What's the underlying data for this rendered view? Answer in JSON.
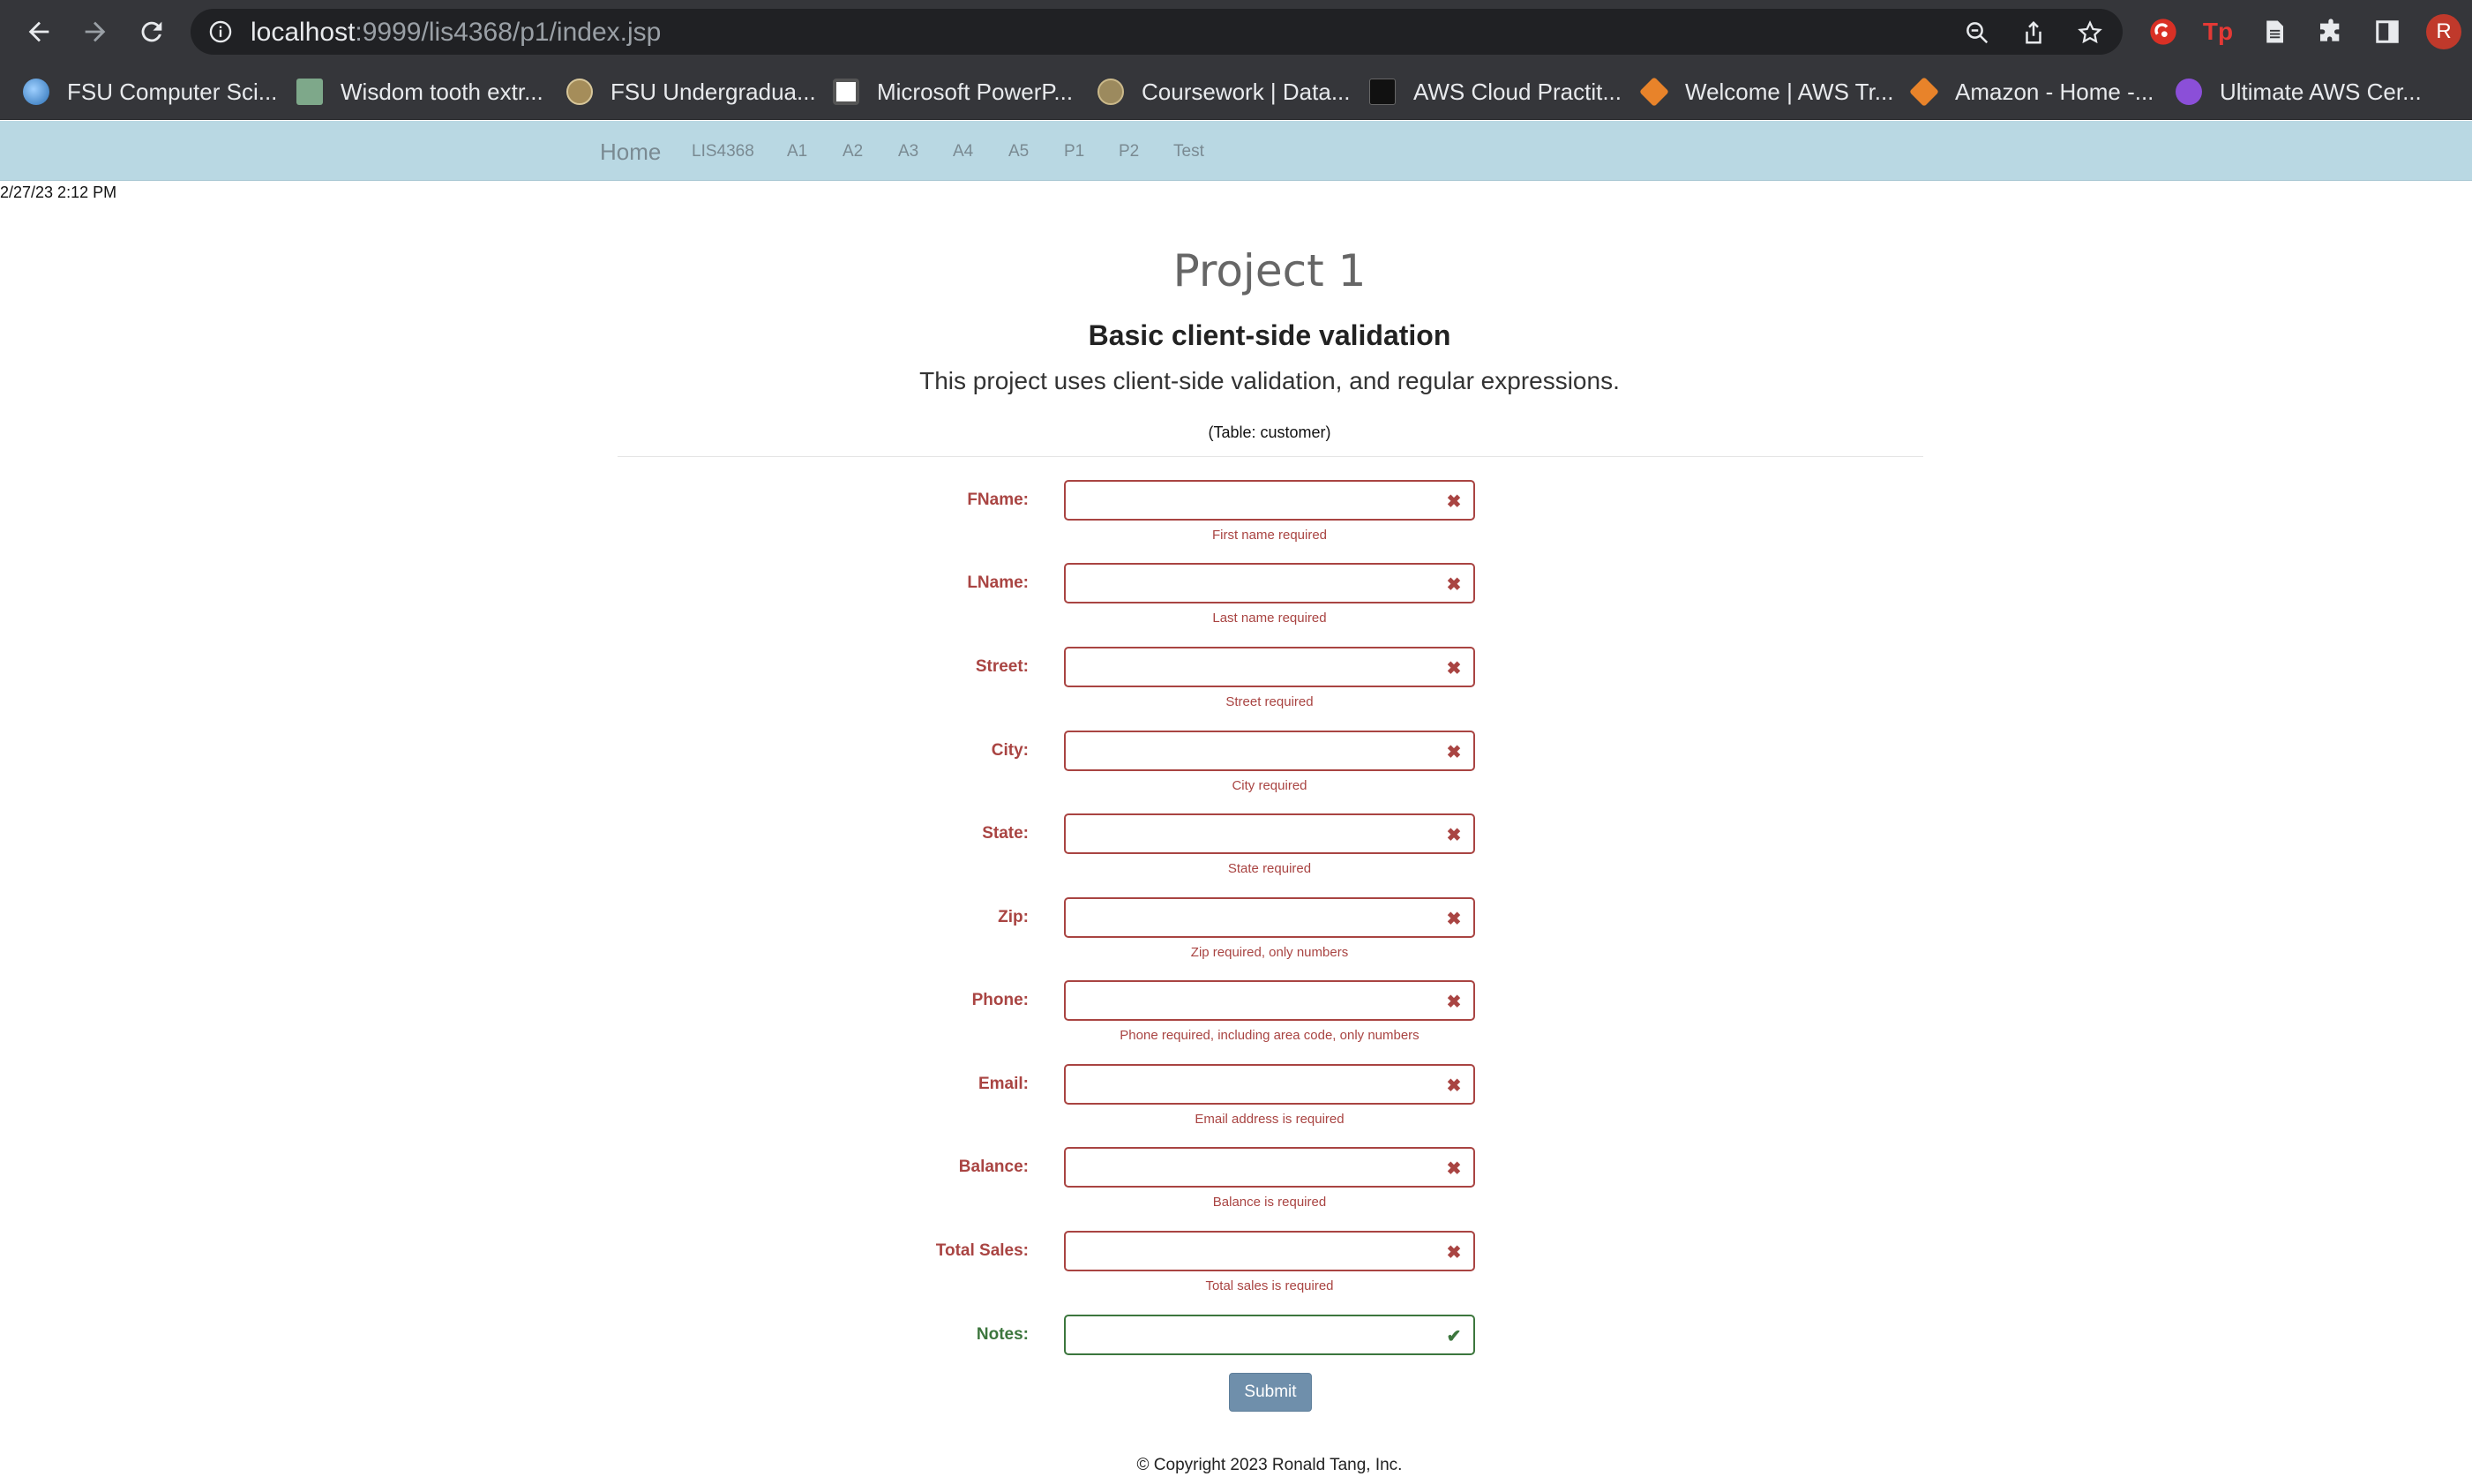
{
  "browser": {
    "url_host": "localhost",
    "url_path": ":9999/lis4368/p1/index.jsp",
    "profile_initial": "R",
    "bookmarks": [
      {
        "label": "FSU Computer Sci..."
      },
      {
        "label": "Wisdom tooth extr..."
      },
      {
        "label": "FSU Undergradua..."
      },
      {
        "label": "Microsoft PowerP..."
      },
      {
        "label": "Coursework | Data..."
      },
      {
        "label": "AWS Cloud Practit..."
      },
      {
        "label": "Welcome | AWS Tr..."
      },
      {
        "label": "Amazon - Home -..."
      },
      {
        "label": "Ultimate AWS Cer..."
      }
    ],
    "extensions": [
      {
        "icon": "red-circle-extension-icon"
      },
      {
        "text": "Tp"
      },
      {
        "icon": "document-icon"
      },
      {
        "icon": "puzzle-icon"
      },
      {
        "icon": "sidebar-icon"
      }
    ]
  },
  "nav": {
    "brand": "Home",
    "links": [
      "LIS4368",
      "A1",
      "A2",
      "A3",
      "A4",
      "A5",
      "P1",
      "P2",
      "Test"
    ]
  },
  "timestamp": "2/27/23 2:12 PM",
  "header": {
    "title": "Project 1",
    "subtitle": "Basic client-side validation",
    "lead": "This project uses client-side validation, and regular expressions.",
    "table_note": "(Table: customer)"
  },
  "form": {
    "fields": [
      {
        "label": "FName:",
        "value": "",
        "help": "First name required",
        "state": "error"
      },
      {
        "label": "LName:",
        "value": "",
        "help": "Last name required",
        "state": "error"
      },
      {
        "label": "Street:",
        "value": "",
        "help": "Street required",
        "state": "error"
      },
      {
        "label": "City:",
        "value": "",
        "help": "City required",
        "state": "error"
      },
      {
        "label": "State:",
        "value": "",
        "help": "State required",
        "state": "error"
      },
      {
        "label": "Zip:",
        "value": "",
        "help": "Zip required, only numbers",
        "state": "error"
      },
      {
        "label": "Phone:",
        "value": "",
        "help": "Phone required, including area code, only numbers",
        "state": "error"
      },
      {
        "label": "Email:",
        "value": "",
        "help": "Email address is required",
        "state": "error"
      },
      {
        "label": "Balance:",
        "value": "",
        "help": "Balance is required",
        "state": "error"
      },
      {
        "label": "Total Sales:",
        "value": "",
        "help": "Total sales is required",
        "state": "error"
      },
      {
        "label": "Notes:",
        "value": "",
        "help": "",
        "state": "success"
      }
    ],
    "submit_label": "Submit",
    "colors": {
      "error": "#a94442",
      "success": "#3c763d"
    }
  },
  "footer": "© Copyright 2023 Ronald Tang, Inc."
}
